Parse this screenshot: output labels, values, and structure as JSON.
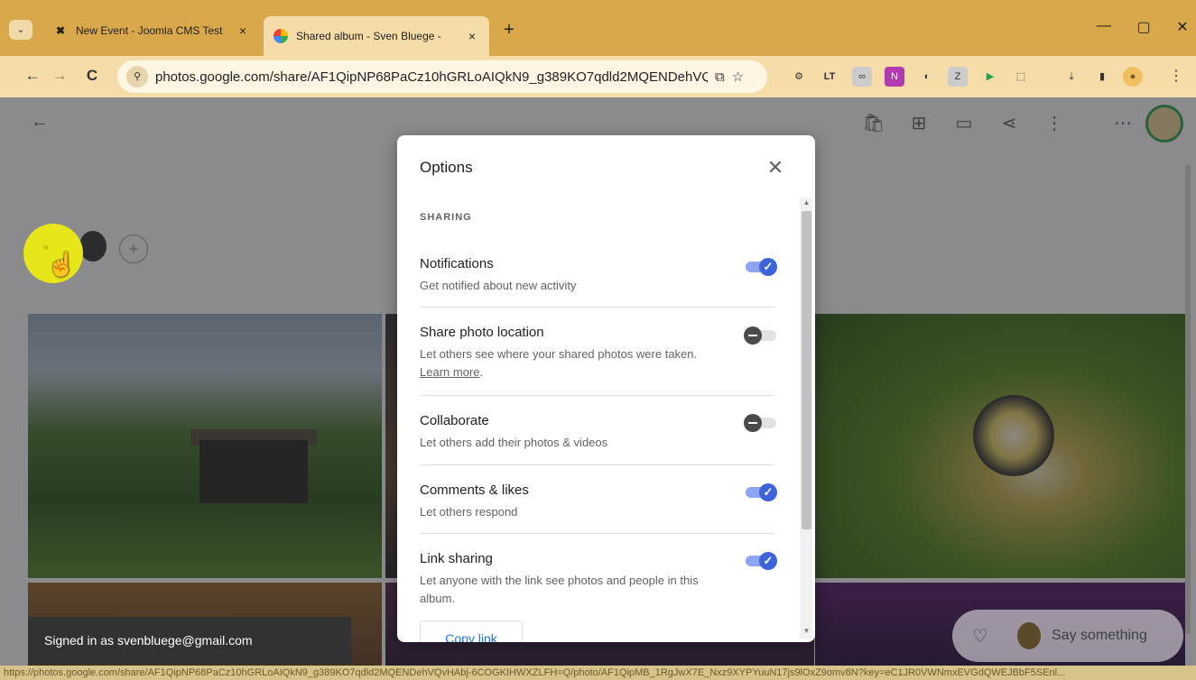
{
  "browser": {
    "tabs": [
      {
        "title": "New Event - Joomla CMS Test",
        "favicon": "joomla-icon",
        "active": false
      },
      {
        "title": "Shared album - Sven Bluege -",
        "favicon": "google-photos-icon",
        "active": true
      }
    ],
    "close_glyph": "×",
    "new_tab_glyph": "+",
    "tab_menu_glyph": "⌄",
    "window_controls": {
      "minimize": "—",
      "maximize": "▢",
      "close": "✕"
    },
    "nav": {
      "back": "←",
      "forward": "→",
      "reload": "C"
    },
    "url": "photos.google.com/share/AF1QipNP68PaCz10hGRLoAIQkN9_g389KO7qdld2MQENDehVQvH...",
    "omnibox_icons": {
      "install": "⧉",
      "bookmark": "☆"
    },
    "extensions": [
      "⚙",
      "LT",
      "∞",
      "N",
      "◐",
      "Z",
      "▶",
      "⬚",
      "⤓",
      "▮",
      "●",
      "⋮"
    ]
  },
  "page": {
    "back_glyph": "←",
    "appbar_icons": [
      "🛍",
      "⊞",
      "▭",
      "⋖",
      "⋮",
      "⋯"
    ],
    "add_member_glyph": "+",
    "link_glyph": "⚭",
    "cursor_glyph": "☝",
    "toast": "Signed in as svenbluege@gmail.com",
    "comment": {
      "heart": "♡",
      "placeholder": "Say something"
    },
    "status_url": "https://photos.google.com/share/AF1QipNP68PaCz10hGRLoAIQkN9_g389KO7qdld2MQENDehVQvHAbj-6COGKIHWXZLFH=Q/photo/AF1QipMB_1RgJwX7E_Nxz9XYPYuuN17js9lOxZ9omv8N?key=eC1JR0VWNmxEVGdQWEJBbF5SEnl..."
  },
  "dialog": {
    "title": "Options",
    "close_glyph": "✕",
    "section": "SHARING",
    "options": [
      {
        "title": "Notifications",
        "desc": "Get notified about new activity",
        "on": true
      },
      {
        "title": "Share photo location",
        "desc": "Let others see where your shared photos were taken.",
        "link": "Learn more",
        "on": false
      },
      {
        "title": "Collaborate",
        "desc": "Let others add their photos & videos",
        "on": false
      },
      {
        "title": "Comments & likes",
        "desc": "Let others respond",
        "on": true
      },
      {
        "title": "Link sharing",
        "desc": "Let anyone with the link see photos and people in this album.",
        "on": true
      }
    ],
    "check_glyph": "✓",
    "copy_link": "Copy link",
    "scroll_up": "▲",
    "scroll_down": "▼"
  },
  "colors": {
    "tabstrip": "#d9a84b",
    "toolbar": "#f5dca8",
    "toggle_on": "#3d64d8",
    "toggle_off": "#4a4a4a",
    "link_blue": "#1a73e8"
  }
}
